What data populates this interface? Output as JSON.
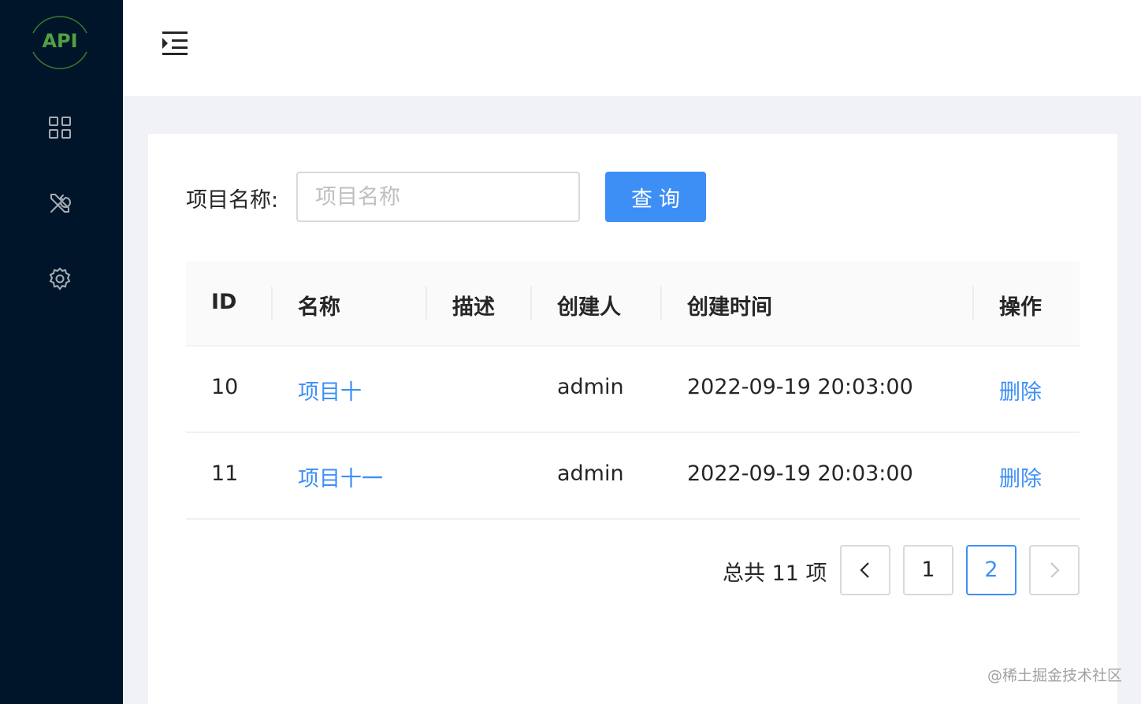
{
  "sidebar": {
    "logo_text": "API",
    "items": [
      {
        "icon": "dashboard-grid-icon"
      },
      {
        "icon": "tools-icon"
      },
      {
        "icon": "settings-gear-icon"
      }
    ]
  },
  "header": {
    "menu_icon": "menu-fold-icon"
  },
  "search": {
    "label": "项目名称:",
    "placeholder": "项目名称",
    "value": "",
    "button_label": "查询"
  },
  "table": {
    "columns": [
      "ID",
      "名称",
      "描述",
      "创建人",
      "创建时间",
      "操作"
    ],
    "rows": [
      {
        "id": "10",
        "name": "项目十",
        "description": "",
        "creator": "admin",
        "created_at": "2022-09-19 20:03:00",
        "action": "删除"
      },
      {
        "id": "11",
        "name": "项目十一",
        "description": "",
        "creator": "admin",
        "created_at": "2022-09-19 20:03:00",
        "action": "删除"
      }
    ]
  },
  "pagination": {
    "total_text": "总共 11 项",
    "pages": [
      "1",
      "2"
    ],
    "current_page": "2",
    "prev_icon": "chevron-left-icon",
    "next_icon": "chevron-right-icon"
  },
  "watermark": "@稀土掘金技术社区",
  "colors": {
    "sidebar_bg": "#001529",
    "primary": "#3d8ff6",
    "logo_green": "#52a042",
    "page_bg": "#f0f2f5"
  }
}
